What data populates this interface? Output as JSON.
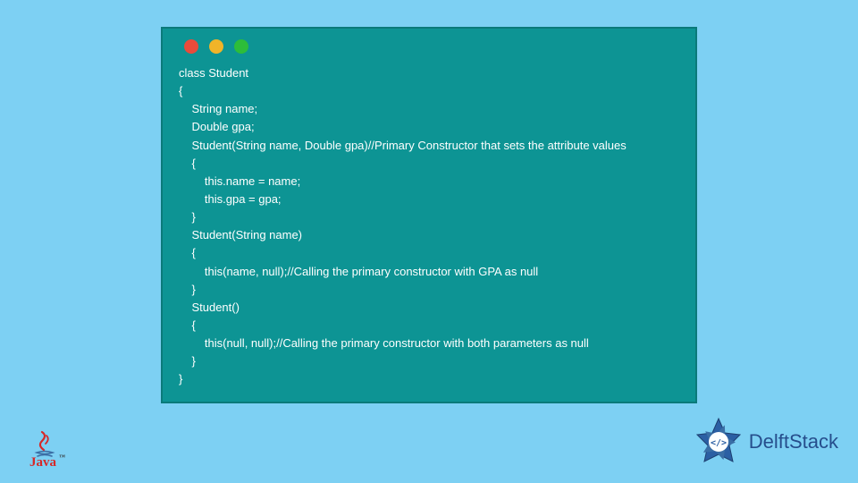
{
  "colors": {
    "background": "#7dd0f3",
    "window_bg": "#0d9494",
    "window_border": "#0b7a7a",
    "code_text": "#ffffff",
    "light_red": "#e94b3b",
    "light_yellow": "#f0b429",
    "light_green": "#2dbd3a",
    "java_red": "#d62828",
    "java_blue": "#3a6ea5",
    "delft_blue": "#264e8c"
  },
  "code_window": {
    "lines": "class Student\n{\n    String name;\n    Double gpa;\n    Student(String name, Double gpa)//Primary Constructor that sets the attribute values\n    {\n        this.name = name;\n        this.gpa = gpa;\n    }\n    Student(String name)\n    {\n        this(name, null);//Calling the primary constructor with GPA as null\n    }\n    Student()\n    {\n        this(null, null);//Calling the primary constructor with both parameters as null\n    }\n}"
  },
  "java_logo": {
    "text": "Java",
    "trademark": "™"
  },
  "delftstack": {
    "text": "DelftStack",
    "icon_glyph": "</>"
  }
}
